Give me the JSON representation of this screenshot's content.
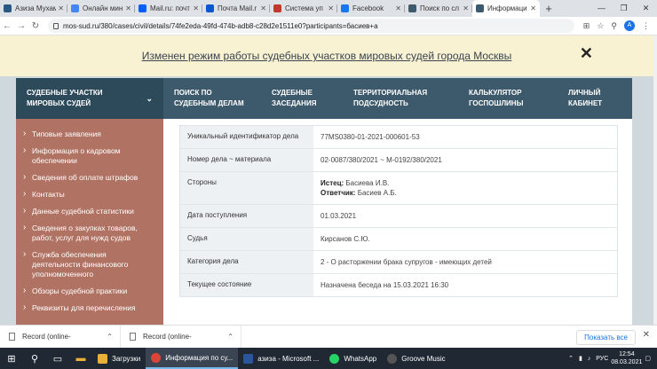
{
  "browser": {
    "tabs": [
      {
        "title": "Азиза Мухам",
        "color": "#2a5885"
      },
      {
        "title": "Онлайн мин",
        "color": "#4285f4"
      },
      {
        "title": "Mail.ru: почт",
        "color": "#005ff9"
      },
      {
        "title": "Почта Mail.r",
        "color": "#0b57d0"
      },
      {
        "title": "Система уп",
        "color": "#c0392b"
      },
      {
        "title": "Facebook",
        "color": "#1877f2"
      },
      {
        "title": "Поиск по сл",
        "color": "#3d5a6c"
      },
      {
        "title": "Информаци",
        "color": "#3d5a6c"
      }
    ],
    "new_tab": "+",
    "url": "mos-sud.ru/380/cases/civil/details/74fe2eda-49fd-474b-adb8-c28d2e1511e0?participants=басиев+а",
    "avatar": "A"
  },
  "notice": {
    "text": "Изменен режим работы судебных участков мировых судей города Москвы",
    "close": "✕"
  },
  "nav": {
    "items": [
      "Судебные участки мировых судей",
      "Поиск по судебным делам",
      "Судебные заседания",
      "Территориальная подсудность",
      "Калькулятор госпошлины",
      "Личный кабинет"
    ]
  },
  "sidebar": {
    "items": [
      "Типовые заявления",
      "Информация о кадровом обеспечении",
      "Сведения об оплате штрафов",
      "Контакты",
      "Данные судебной статистики",
      "Сведения о закупках товаров, работ, услуг для нужд судов",
      "Служба обеспечения деятельности финансового уполномоченного",
      "Обзоры судебной практики",
      "Реквизиты для перечисления"
    ]
  },
  "case": {
    "rows": [
      {
        "label": "Уникальный идентификатор дела",
        "value": "77MS0380-01-2021-000601-53"
      },
      {
        "label": "Номер дела ~ материала",
        "value": "02-0087/380/2021 ~ М-0192/380/2021"
      },
      {
        "label": "Стороны",
        "plaintiff_label": "Истец:",
        "plaintiff": "Басиева И.В.",
        "defendant_label": "Ответчик:",
        "defendant": "Басиев А.Б."
      },
      {
        "label": "Дата поступления",
        "value": "01.03.2021"
      },
      {
        "label": "Судья",
        "value": "Кирсанов С.Ю."
      },
      {
        "label": "Категория дела",
        "value": "2 - О расторжении брака супругов - имеющих детей"
      },
      {
        "label": "Текущее состояние",
        "value": "Назначена беседа на 15.03.2021 16:30"
      }
    ]
  },
  "downloads": {
    "items": [
      "Record (online-",
      "Record (online-"
    ],
    "show_all": "Показать все"
  },
  "taskbar": {
    "apps": [
      {
        "label": "Загрузки",
        "color": "#e8b23a"
      },
      {
        "label": "Информация по су...",
        "color": "#db4437",
        "active": true
      },
      {
        "label": "азиза - Microsoft ...",
        "color": "#2b579a"
      },
      {
        "label": "WhatsApp",
        "color": "#25d366"
      },
      {
        "label": "Groove Music",
        "color": "#555555"
      }
    ],
    "lang": "РУС",
    "time": "12:54",
    "date": "08.03.2021"
  }
}
